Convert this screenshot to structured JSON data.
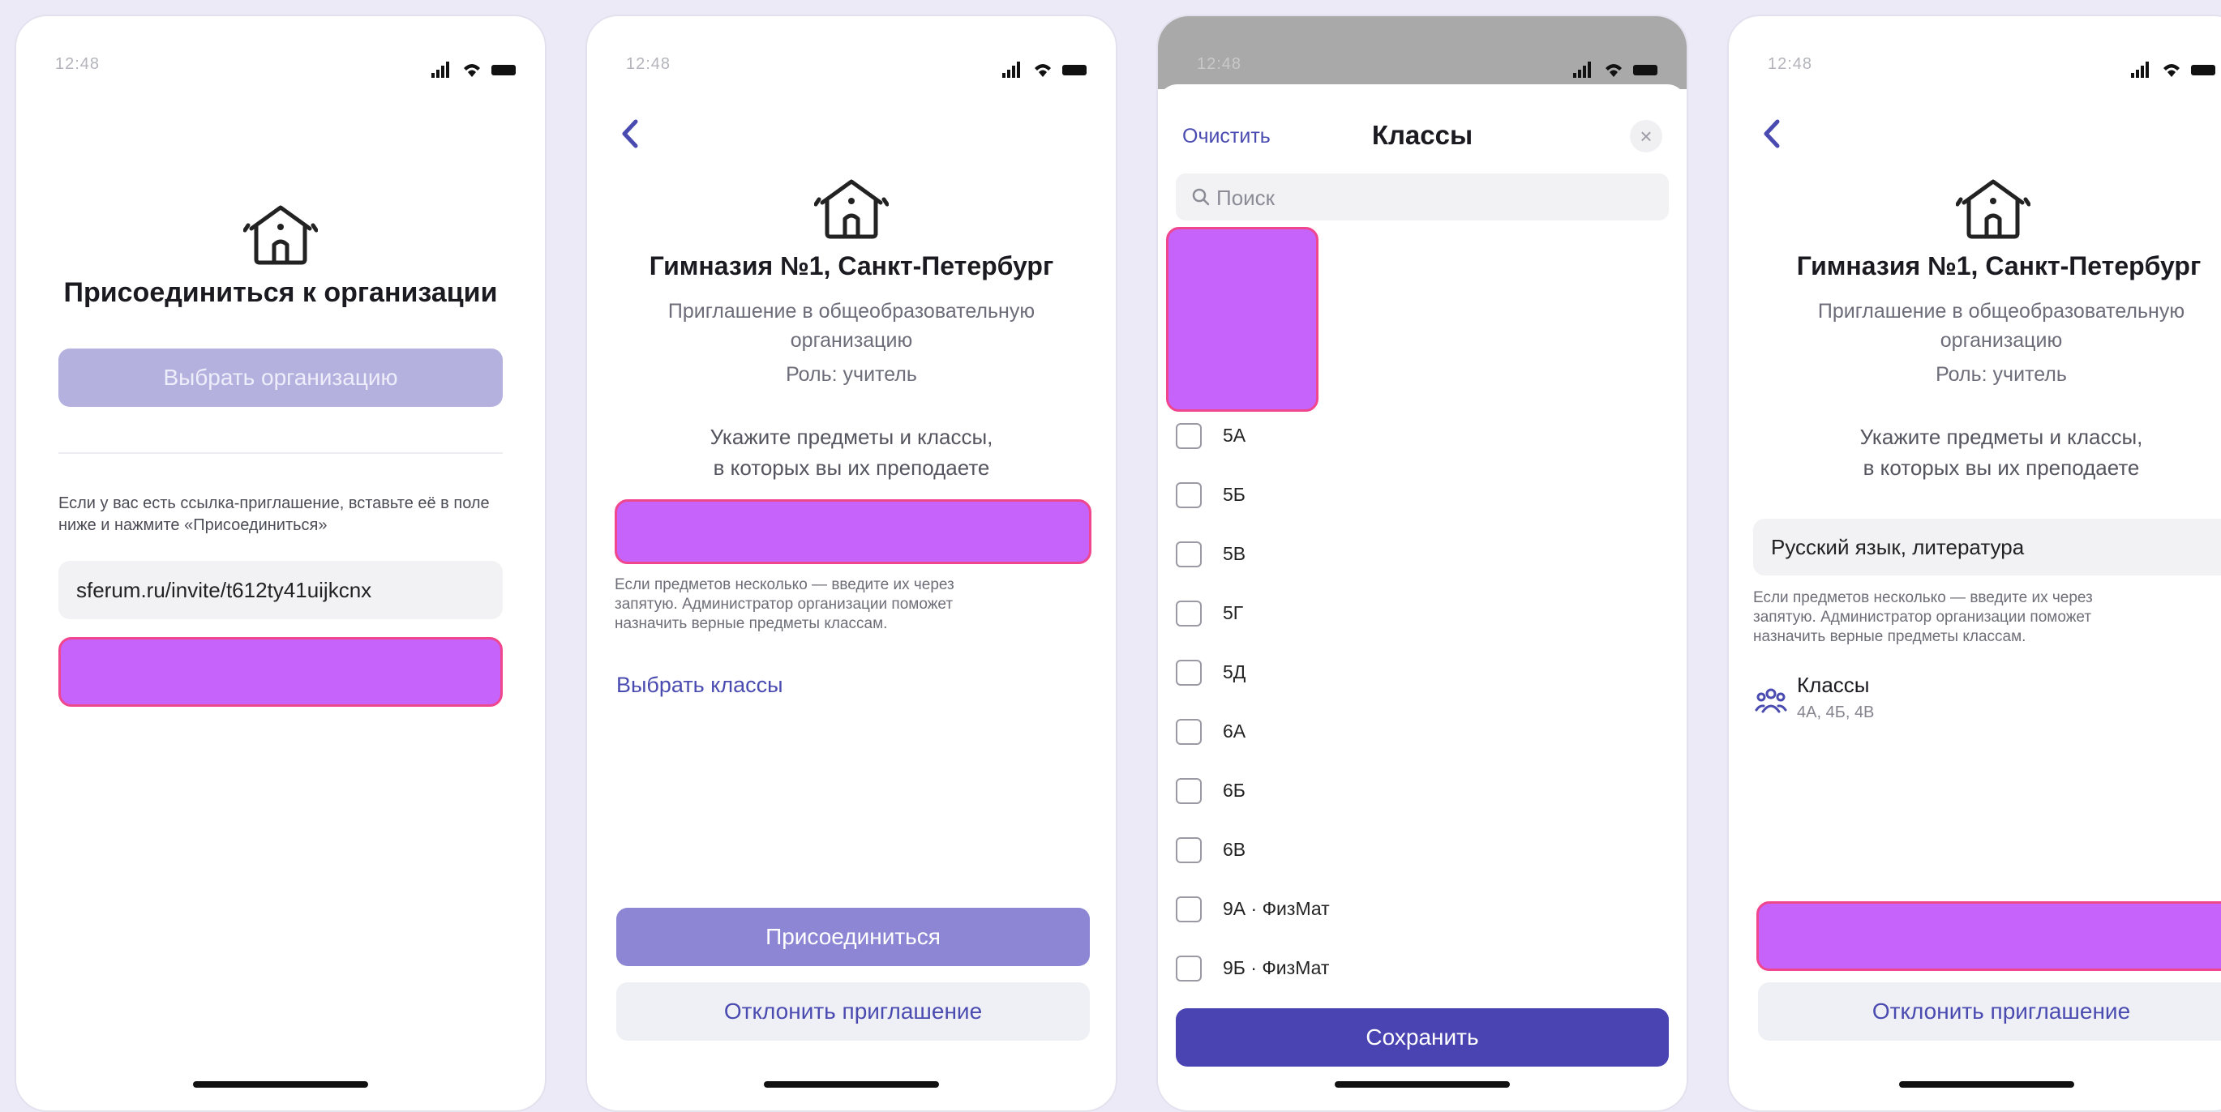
{
  "status": {
    "time": "12:48"
  },
  "screen1": {
    "title": "Присоединиться к организации",
    "select_org_label": "Выбрать организацию",
    "hint": "Если у вас есть ссылка-приглашение, вставьте её в поле ниже и нажмите «Присоединиться»",
    "invite_value": "sferum.ru/invite/t612ty41uijkcnx"
  },
  "invite": {
    "org_name": "Гимназия №1, Санкт-Петербург",
    "invite_line1": "Приглашение в общеобразовательную",
    "invite_line2": "организацию",
    "role": "Роль: учитель",
    "prompt_line1": "Укажите предметы и классы,",
    "prompt_line2": "в которых вы их преподаете",
    "note_line1": "Если предметов несколько — введите их через",
    "note_line2": "запятую. Администратор организации поможет",
    "note_line3": "назначить верные предметы классам.",
    "choose_classes": "Выбрать классы",
    "join_label": "Присоединиться",
    "decline_label": "Отклонить приглашение"
  },
  "classes_modal": {
    "clear_label": "Очистить",
    "title": "Классы",
    "close_glyph": "×",
    "search_placeholder": "Поиск",
    "items": [
      "5А",
      "5Б",
      "5В",
      "5Г",
      "5Д",
      "6А",
      "6Б",
      "6В",
      "9А · ФизМат",
      "9Б · ФизМат"
    ],
    "save_label": "Сохранить"
  },
  "screen4": {
    "subjects_value": "Русский язык, литература",
    "classes_title": "Классы",
    "classes_value": "4А, 4Б, 4В",
    "chevron": "›"
  },
  "colors": {
    "accent": "#4a43b2",
    "accent_disabled": "#b5b1df",
    "join_button": "#8c86d4",
    "redaction": "#c563fa",
    "redaction_border": "#f0468d"
  }
}
